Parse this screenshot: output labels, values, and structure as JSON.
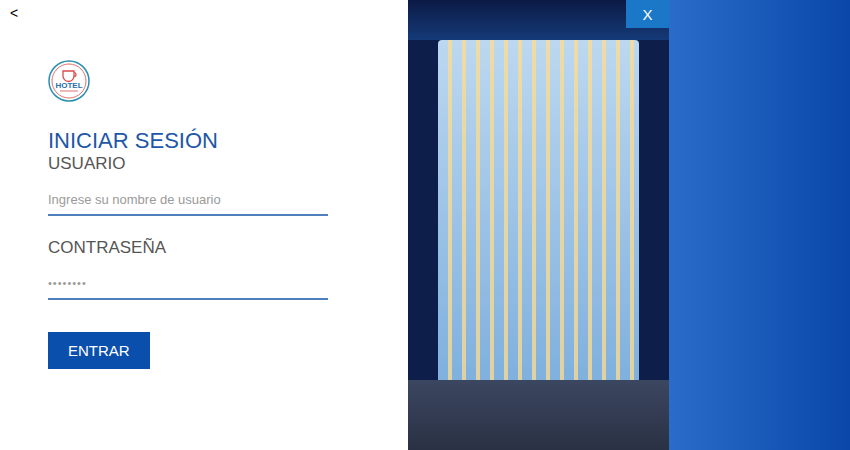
{
  "back_button": "<",
  "close_button": "X",
  "logo": {
    "text": "HOTEL"
  },
  "title": "INICIAR SESIÓN",
  "fields": [
    {
      "label": "USUARIO",
      "kind": "text",
      "placeholder": "Ingrese su nombre de usuario",
      "value": ""
    },
    {
      "label": "CONTRASEÑA",
      "kind": "password",
      "placeholder": "",
      "value": "••••••••"
    }
  ],
  "submit_button": "ENTRAR"
}
